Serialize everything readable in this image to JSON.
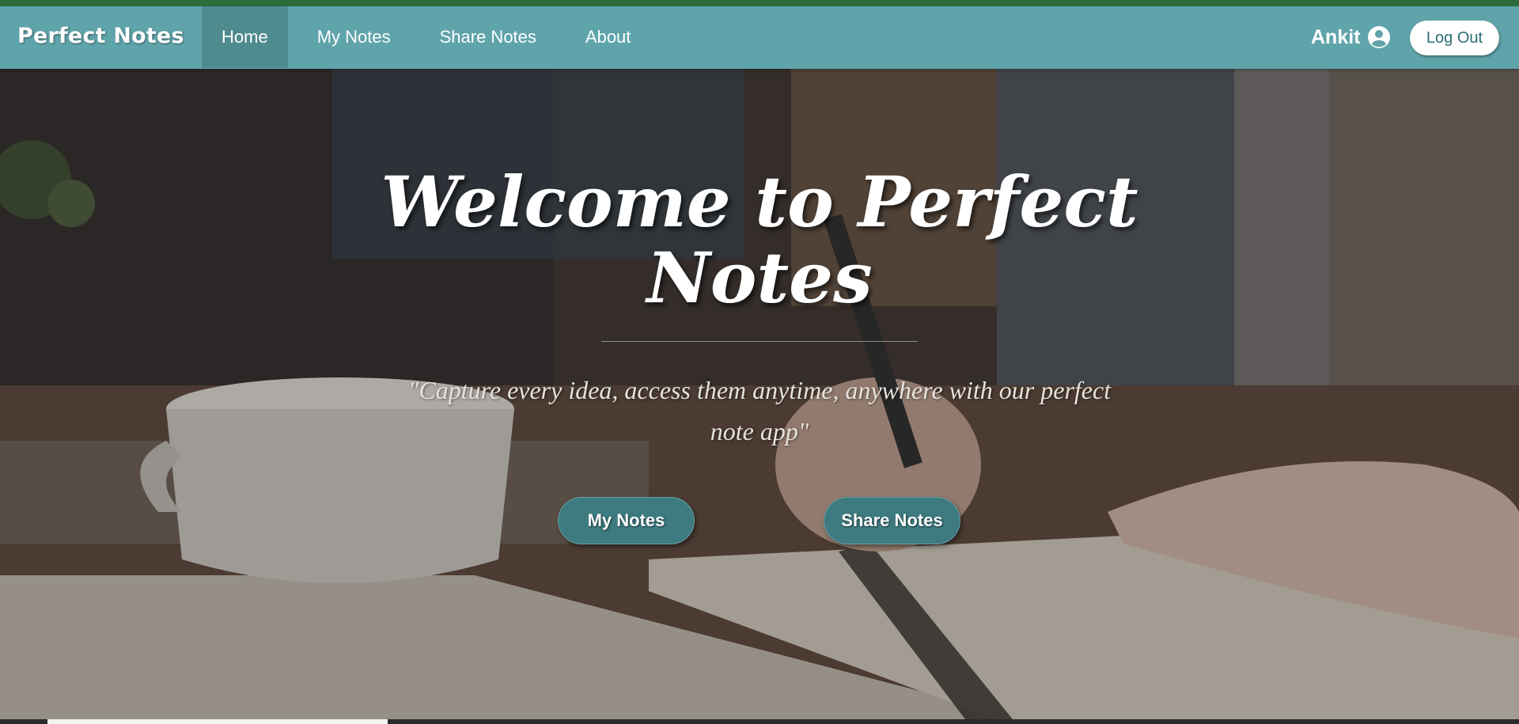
{
  "navbar": {
    "brand": "Perfect Notes",
    "links": [
      {
        "label": "Home",
        "active": true
      },
      {
        "label": "My Notes",
        "active": false
      },
      {
        "label": "Share Notes",
        "active": false
      },
      {
        "label": "About",
        "active": false
      }
    ],
    "user_name": "Ankit",
    "user_icon": "user-circle-icon",
    "logout_label": "Log Out"
  },
  "hero": {
    "title": "Welcome to Perfect Notes",
    "quote": "\"Capture every idea, access them anytime, anywhere with our perfect note app\"",
    "buttons": [
      "My Notes",
      "Share Notes"
    ]
  },
  "colors": {
    "navbar": "#5fa4aa",
    "nav_active": "#4e8b8f",
    "top_strip": "#2e6b3a",
    "button": "#3d7b80"
  }
}
